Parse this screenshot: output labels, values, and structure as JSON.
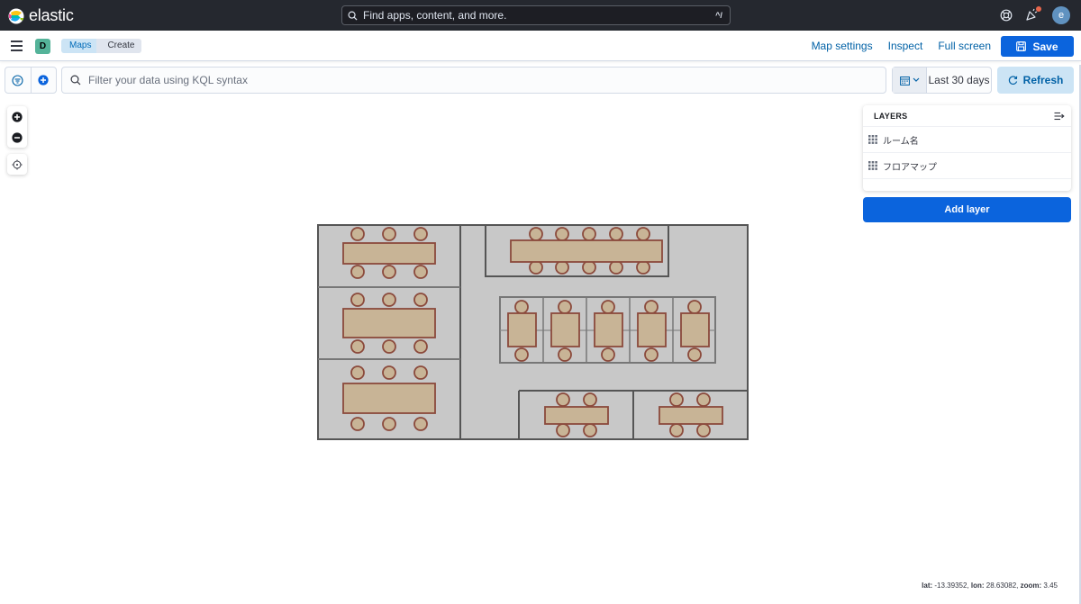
{
  "header": {
    "brand": "elastic",
    "search_placeholder": "Find apps, content, and more.",
    "search_shortcut": "^/",
    "avatar_initial": "e",
    "icons": [
      "help-icon",
      "newsfeed-icon",
      "user-avatar"
    ],
    "colors": {
      "header_bg": "#25282f",
      "notification_dot": "#e7664c"
    }
  },
  "navbar": {
    "space_initial": "D",
    "breadcrumbs": [
      "Maps",
      "Create"
    ],
    "links": [
      "Map settings",
      "Inspect",
      "Full screen"
    ],
    "save_label": "Save"
  },
  "querybar": {
    "kql_placeholder": "Filter your data using KQL syntax",
    "date_range": "Last 30 days",
    "refresh_label": "Refresh"
  },
  "layers": {
    "title": "LAYERS",
    "items": [
      {
        "name": "ルーム名",
        "icon": "grid-icon"
      },
      {
        "name": "フロアマップ",
        "icon": "grid-icon"
      }
    ],
    "add_layer_label": "Add layer"
  },
  "status": {
    "lat_label": "lat:",
    "lat": "-13.39352,",
    "lon_label": "lon:",
    "lon": "28.63082,",
    "zoom_label": "zoom:",
    "zoom": "3.45"
  },
  "colors": {
    "accent": "#0b64dd",
    "floor_fill": "#c8c8c8",
    "table_fill": "#c8b496",
    "furniture_stroke": "#8b4a3c"
  }
}
